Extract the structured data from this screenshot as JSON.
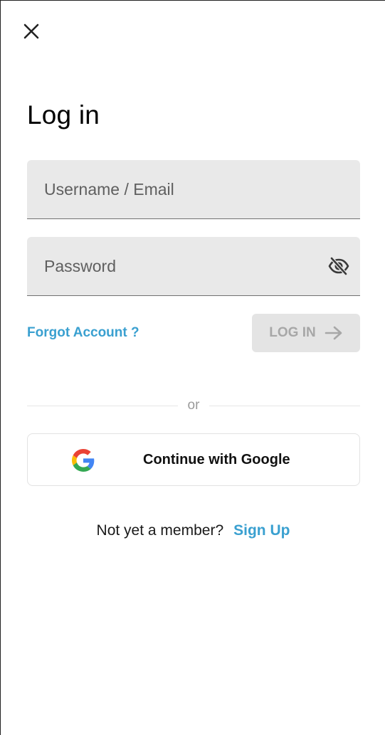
{
  "modal": {
    "close_icon": "close-icon",
    "title": "Log in"
  },
  "form": {
    "username": {
      "placeholder": "Username / Email",
      "value": ""
    },
    "password": {
      "placeholder": "Password",
      "value": "",
      "toggle_icon": "eye-slash-icon"
    },
    "forgot_label": "Forgot Account ?",
    "login_label": "LOG IN",
    "login_icon": "arrow-right-icon",
    "login_enabled": false
  },
  "divider": {
    "label": "or"
  },
  "google": {
    "icon": "google-icon",
    "label": "Continue with Google"
  },
  "signup": {
    "prompt": "Not yet a member?",
    "link_label": "Sign Up"
  },
  "colors": {
    "accent": "#3aa0d0",
    "field_bg": "#e9e9e9",
    "disabled_bg": "#e4e4e4",
    "disabled_text": "#a7a7a7"
  }
}
